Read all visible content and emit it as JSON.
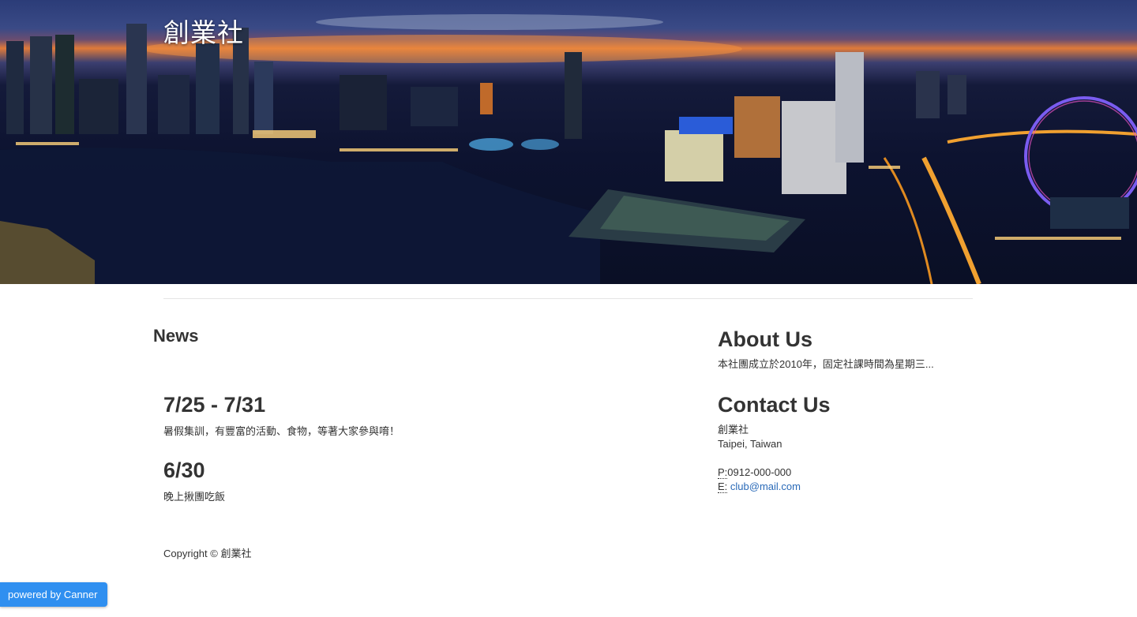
{
  "header": {
    "site_title": "創業社"
  },
  "news": {
    "heading": "News",
    "items": [
      {
        "date": "7/25 - 7/31",
        "text": "暑假集訓，有豐富的活動、食物，等著大家參與唷！"
      },
      {
        "date": "6/30",
        "text": "晚上揪團吃飯"
      }
    ]
  },
  "about": {
    "heading": "About Us",
    "text": "本社團成立於2010年，固定社課時間為星期三..."
  },
  "contact": {
    "heading": "Contact Us",
    "name": "創業社",
    "location": "Taipei, Taiwan",
    "phone_label": "P:",
    "phone": "0912-000-000",
    "email_label": "E:",
    "email": "club@mail.com"
  },
  "footer": {
    "copyright": "Copyright © 創業社"
  },
  "badge": {
    "label": "powered by Canner"
  },
  "colors": {
    "link": "#2a6ab8",
    "badge": "#2f8ff0"
  }
}
